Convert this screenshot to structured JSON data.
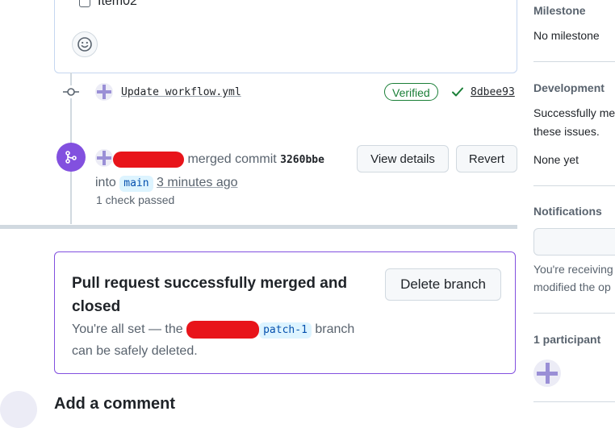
{
  "task_list": {
    "item_label": "Item02"
  },
  "timeline": {
    "commit": {
      "message": "Update workflow.yml",
      "badge": "Verified",
      "sha": "8dbee93"
    },
    "merge_event": {
      "action": "merged commit",
      "commit_sha": "3260bbe",
      "into_word": "into",
      "branch": "main",
      "time": "3 minutes ago",
      "checks": "1 check passed",
      "view_details_label": "View details",
      "revert_label": "Revert"
    }
  },
  "merged_box": {
    "title": "Pull request successfully merged and closed",
    "desc_prefix": "You're all set — the",
    "branch": "patch-1",
    "desc_suffix": "branch",
    "desc_line2": "can be safely deleted.",
    "delete_branch_label": "Delete branch"
  },
  "add_comment": {
    "heading": "Add a comment"
  },
  "sidebar": {
    "milestone": {
      "label": "Milestone",
      "value": "No milestone"
    },
    "development": {
      "label": "Development",
      "line1": "Successfully me",
      "line2": "these issues.",
      "value": "None yet"
    },
    "notifications": {
      "label": "Notifications",
      "line1": "You're receiving",
      "line2": "modified the op"
    },
    "participants": {
      "label": "1 participant"
    }
  },
  "colors": {
    "merged_purple": "#8250df",
    "verified_green": "#1a7f37",
    "branch_chip_bg": "#ddf4ff",
    "redaction_red": "#e8141a"
  }
}
